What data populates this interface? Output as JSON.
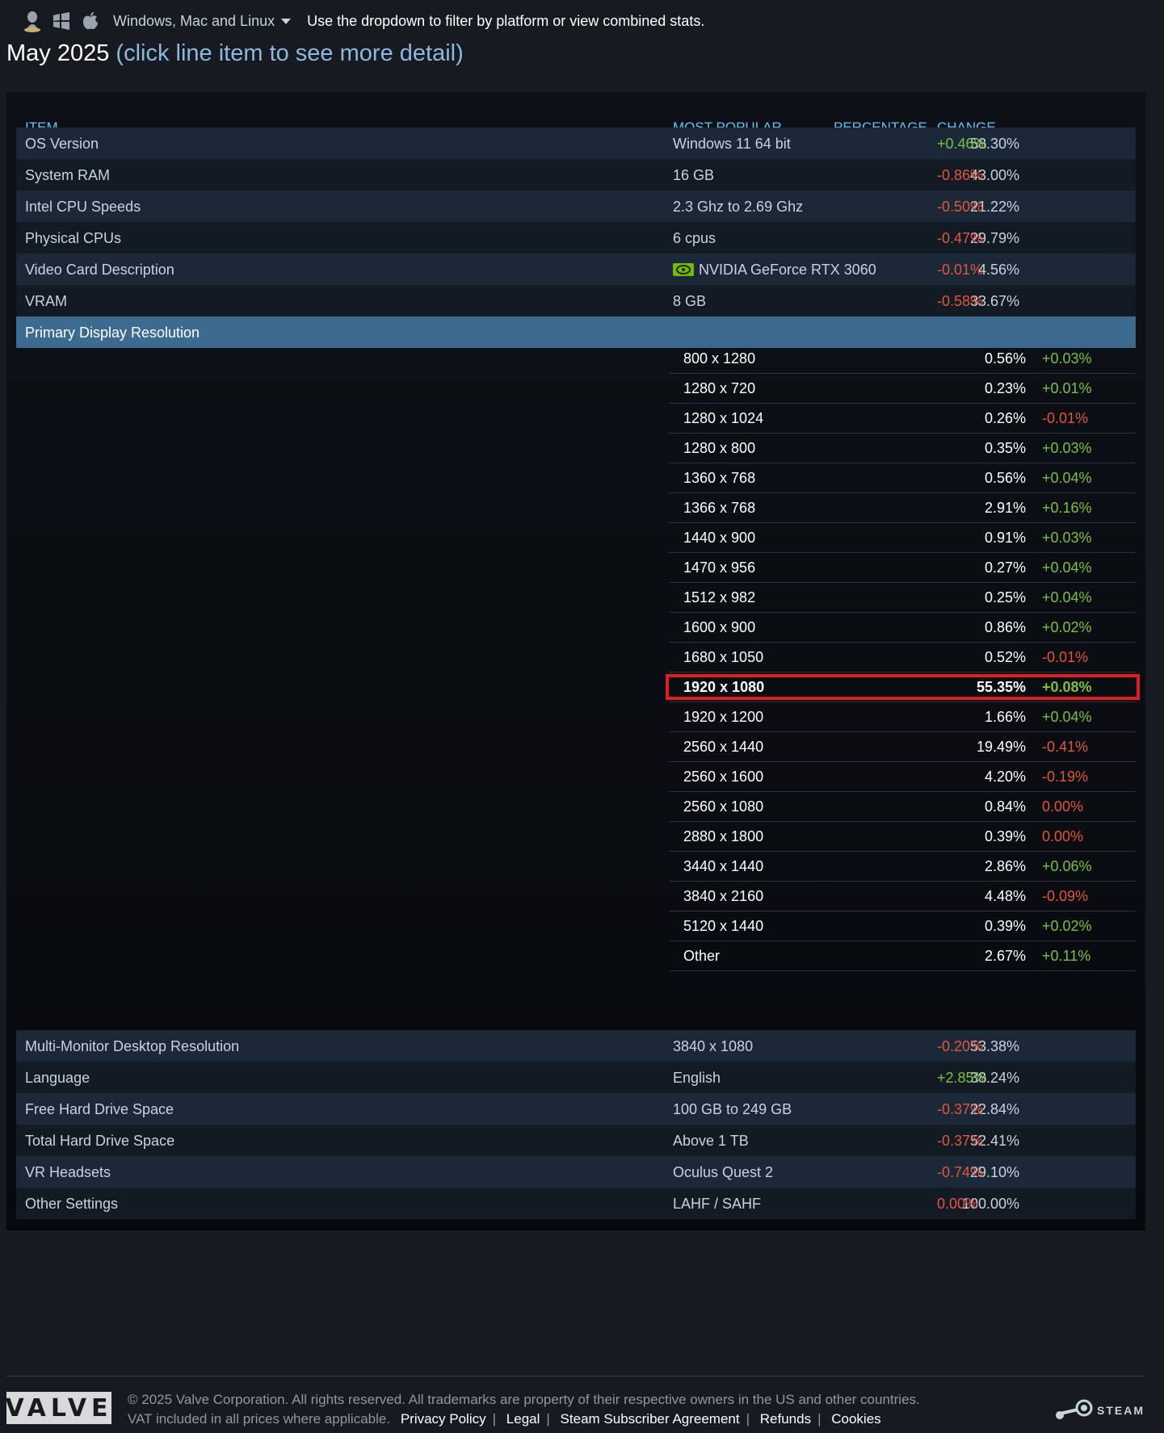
{
  "topbar": {
    "platform_label": "Windows, Mac and Linux",
    "hint": "Use the dropdown to filter by platform or view combined stats."
  },
  "heading": {
    "title": "May 2025",
    "subtitle": "(click line item to see more detail)"
  },
  "table": {
    "headers": {
      "item": "ITEM",
      "most_popular": "MOST POPULAR",
      "percentage": "PERCENTAGE",
      "change": "CHANGE"
    },
    "rows_top": [
      {
        "item": "OS Version",
        "popular": "Windows 11 64 bit",
        "pct": "58.30%",
        "chg": "+0.46%"
      },
      {
        "item": "System RAM",
        "popular": "16 GB",
        "pct": "43.00%",
        "chg": "-0.86%"
      },
      {
        "item": "Intel CPU Speeds",
        "popular": "2.3 Ghz to 2.69 Ghz",
        "pct": "21.22%",
        "chg": "-0.50%"
      },
      {
        "item": "Physical CPUs",
        "popular": "6 cpus",
        "pct": "29.79%",
        "chg": "-0.47%"
      },
      {
        "item": "Video Card Description",
        "popular": "NVIDIA GeForce RTX 3060",
        "pct": "4.56%",
        "chg": "-0.01%"
      },
      {
        "item": "VRAM",
        "popular": "8 GB",
        "pct": "33.67%",
        "chg": "-0.58%"
      }
    ],
    "expanded_row": {
      "item": "Primary Display Resolution"
    },
    "resolutions": [
      {
        "res": "800 x 1280",
        "pct": "0.56%",
        "chg": "+0.03%"
      },
      {
        "res": "1280 x 720",
        "pct": "0.23%",
        "chg": "+0.01%"
      },
      {
        "res": "1280 x 1024",
        "pct": "0.26%",
        "chg": "-0.01%"
      },
      {
        "res": "1280 x 800",
        "pct": "0.35%",
        "chg": "+0.03%"
      },
      {
        "res": "1360 x 768",
        "pct": "0.56%",
        "chg": "+0.04%"
      },
      {
        "res": "1366 x 768",
        "pct": "2.91%",
        "chg": "+0.16%"
      },
      {
        "res": "1440 x 900",
        "pct": "0.91%",
        "chg": "+0.03%"
      },
      {
        "res": "1470 x 956",
        "pct": "0.27%",
        "chg": "+0.04%"
      },
      {
        "res": "1512 x 982",
        "pct": "0.25%",
        "chg": "+0.04%"
      },
      {
        "res": "1600 x 900",
        "pct": "0.86%",
        "chg": "+0.02%"
      },
      {
        "res": "1680 x 1050",
        "pct": "0.52%",
        "chg": "-0.01%"
      },
      {
        "res": "1920 x 1080",
        "pct": "55.35%",
        "chg": "+0.08%"
      },
      {
        "res": "1920 x 1200",
        "pct": "1.66%",
        "chg": "+0.04%"
      },
      {
        "res": "2560 x 1440",
        "pct": "19.49%",
        "chg": "-0.41%"
      },
      {
        "res": "2560 x 1600",
        "pct": "4.20%",
        "chg": "-0.19%"
      },
      {
        "res": "2560 x 1080",
        "pct": "0.84%",
        "chg": "0.00%"
      },
      {
        "res": "2880 x 1800",
        "pct": "0.39%",
        "chg": "0.00%"
      },
      {
        "res": "3440 x 1440",
        "pct": "2.86%",
        "chg": "+0.06%"
      },
      {
        "res": "3840 x 2160",
        "pct": "4.48%",
        "chg": "-0.09%"
      },
      {
        "res": "5120 x 1440",
        "pct": "0.39%",
        "chg": "+0.02%"
      },
      {
        "res": "Other",
        "pct": "2.67%",
        "chg": "+0.11%"
      }
    ],
    "rows_bottom": [
      {
        "item": "Multi-Monitor Desktop Resolution",
        "popular": "3840 x 1080",
        "pct": "53.38%",
        "chg": "-0.20%"
      },
      {
        "item": "Language",
        "popular": "English",
        "pct": "38.24%",
        "chg": "+2.85%"
      },
      {
        "item": "Free Hard Drive Space",
        "popular": "100 GB to 249 GB",
        "pct": "22.84%",
        "chg": "-0.37%"
      },
      {
        "item": "Total Hard Drive Space",
        "popular": "Above 1 TB",
        "pct": "52.41%",
        "chg": "-0.37%"
      },
      {
        "item": "VR Headsets",
        "popular": "Oculus Quest 2",
        "pct": "29.10%",
        "chg": "-0.74%"
      },
      {
        "item": "Other Settings",
        "popular": "LAHF / SAHF",
        "pct": "100.00%",
        "chg": "0.00%"
      }
    ]
  },
  "footer": {
    "valve_logo": "VALVE",
    "copyright": "© 2025 Valve Corporation. All rights reserved. All trademarks are property of their respective owners in the US and other countries.",
    "vat": "VAT included in all prices where applicable.",
    "links": [
      "Privacy Policy",
      "Legal",
      "Steam Subscriber Agreement",
      "Refunds",
      "Cookies"
    ],
    "steam_logo": "STEAM"
  },
  "colors": {
    "accent": "#66c0f4",
    "positive": "#7bc043",
    "negative": "#e0573f",
    "expanded_row": "#3d6a8f",
    "highlight_box": "#e01c24"
  },
  "icons": [
    "linux-icon",
    "windows-icon",
    "apple-icon",
    "nvidia-icon",
    "steam-icon"
  ]
}
